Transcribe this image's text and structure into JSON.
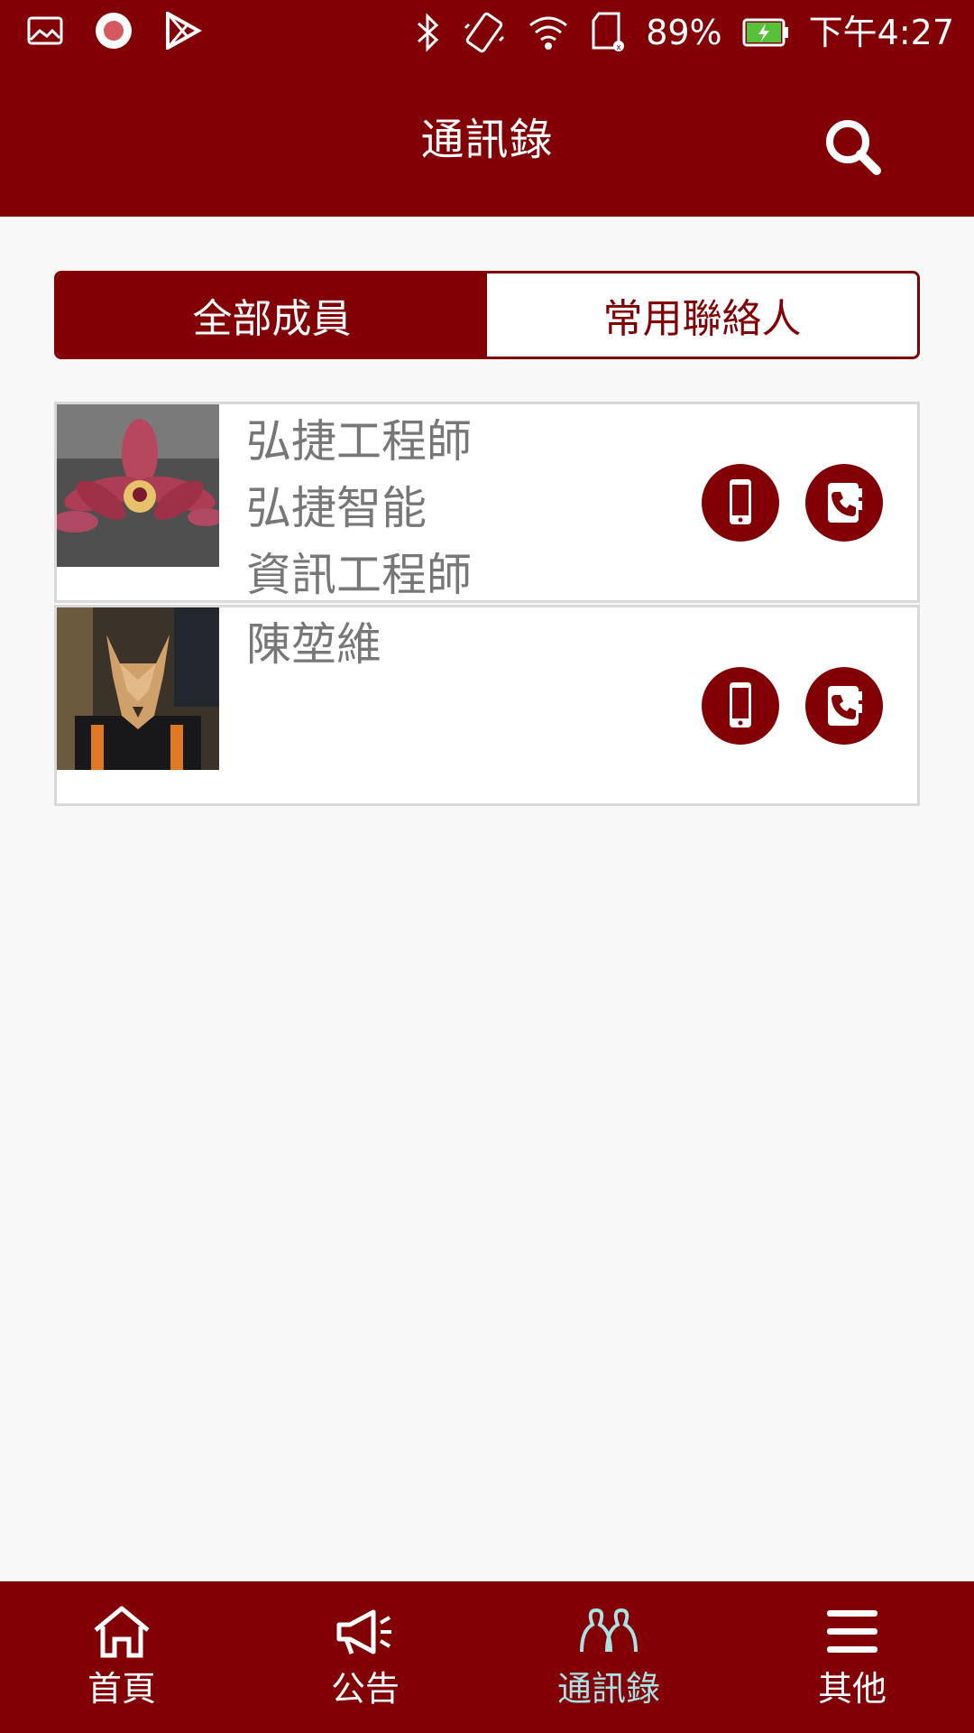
{
  "status_bar": {
    "battery_text": "89%",
    "time_text": "下午4:27",
    "icons": [
      "image-icon",
      "record-icon",
      "play-store-icon",
      "bluetooth-icon",
      "vibrate-icon",
      "wifi-icon",
      "sd-card-icon",
      "battery-charging-icon"
    ]
  },
  "header": {
    "title": "通訊錄",
    "search_icon": "search-icon"
  },
  "tabs": {
    "all_members": "全部成員",
    "favorites": "常用聯絡人",
    "active": "all_members"
  },
  "contacts": [
    {
      "lines": [
        "弘捷工程師",
        "弘捷智能",
        "資訊工程師"
      ],
      "avatar": "orchid-photo",
      "actions": [
        "mobile-phone-icon",
        "phone-book-icon"
      ]
    },
    {
      "lines": [
        "陳堃維"
      ],
      "avatar": "fox-mask-photo",
      "actions": [
        "mobile-phone-icon",
        "phone-book-icon"
      ]
    }
  ],
  "bottom_nav": [
    {
      "label": "首頁",
      "icon": "home-icon"
    },
    {
      "label": "公告",
      "icon": "megaphone-icon"
    },
    {
      "label": "通訊錄",
      "icon": "contacts-icon",
      "active": true
    },
    {
      "label": "其他",
      "icon": "menu-icon"
    }
  ],
  "colors": {
    "brand": "#820005",
    "active_nav": "#a8e2e4",
    "text_gray": "#777777"
  }
}
